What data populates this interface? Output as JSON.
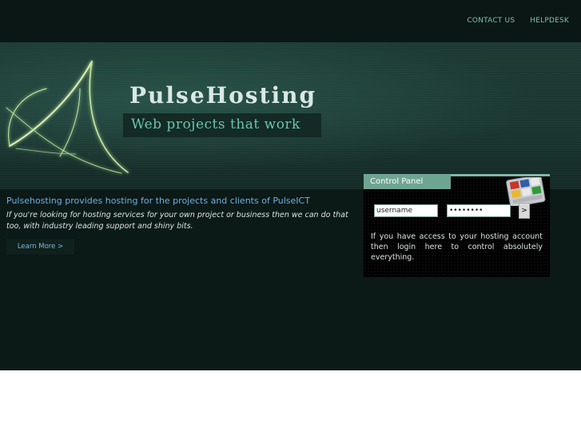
{
  "nav": {
    "contact_us": "CONTACT US",
    "helpdesk": "HELPDESK"
  },
  "banner": {
    "brand_name": "PulseHosting",
    "tagline": "Web projects that work"
  },
  "intro": {
    "heading": "Pulsehosting provides hosting for the projects and clients of PulseICT",
    "text": "If you're looking for hosting services for your own project or business then we can do that too, with industry leading support and shiny bits.",
    "learn_more": "Learn More >"
  },
  "control_panel": {
    "title": "Control Panel",
    "username_value": "username",
    "password_value": "password",
    "submit_label": ">",
    "note": "If you have access to your hosting account then login here to control absolutely everything."
  },
  "icons": {
    "logo": "pulse-logo-icon",
    "control_panel": "control-panel-grid-icon"
  },
  "colors": {
    "page_bg": "#0b1917",
    "accent": "#6ea592",
    "nav_text": "#7fc0ac",
    "heading_text": "#6fb0e0"
  }
}
